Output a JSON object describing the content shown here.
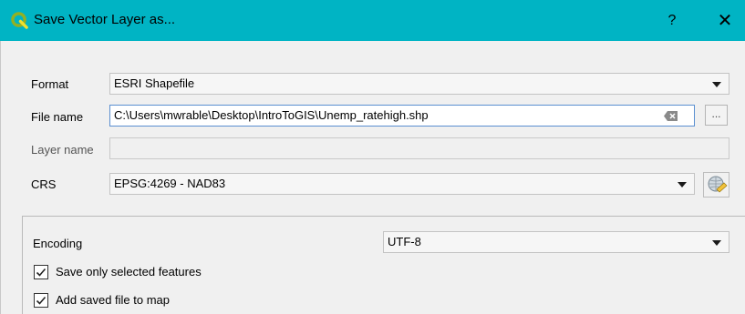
{
  "window": {
    "title": "Save Vector Layer as...",
    "help_label": "?",
    "close_label": "✕"
  },
  "form": {
    "format_label": "Format",
    "format_value": "ESRI Shapefile",
    "filename_label": "File name",
    "filename_value": "C:\\Users\\mwrable\\Desktop\\IntroToGIS\\Unemp_ratehigh.shp",
    "browse_label": "...",
    "layername_label": "Layer name",
    "layername_value": "",
    "crs_label": "CRS",
    "crs_value": "EPSG:4269 - NAD83"
  },
  "options": {
    "encoding_label": "Encoding",
    "encoding_value": "UTF-8",
    "save_selected_label": "Save only selected features",
    "save_selected_checked": true,
    "add_to_map_label": "Add saved file to map",
    "add_to_map_checked": true
  },
  "colors": {
    "titlebar": "#00b4c4",
    "logo_green": "#93b023"
  }
}
